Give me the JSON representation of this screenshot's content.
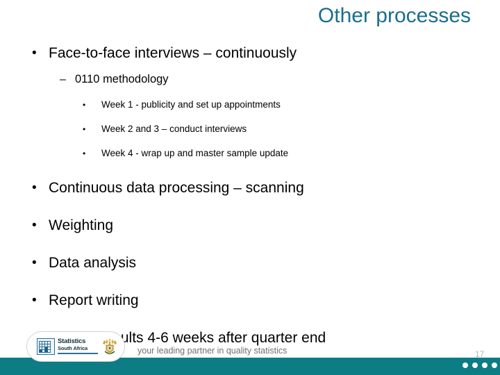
{
  "slide": {
    "title": "Other processes",
    "page_number": "17",
    "title_color": "#1a6d8e",
    "band_color": "#0c7c85"
  },
  "content": {
    "bullets": [
      {
        "level": 1,
        "marker": "•",
        "text": "Face-to-face interviews – continuously"
      },
      {
        "level": 2,
        "marker": "–",
        "text": "0110 methodology"
      },
      {
        "level": 3,
        "marker": "•",
        "text": "Week 1  - publicity and set up appointments"
      },
      {
        "level": 3,
        "marker": "•",
        "text": "Week 2 and 3 – conduct interviews"
      },
      {
        "level": 3,
        "marker": "•",
        "text": "Week 4  - wrap up and master sample update"
      },
      {
        "level": 1,
        "marker": "•",
        "text": "Continuous data processing – scanning"
      },
      {
        "level": 1,
        "marker": "•",
        "text": "Weighting"
      },
      {
        "level": 1,
        "marker": "•",
        "text": "Data analysis"
      },
      {
        "level": 1,
        "marker": "•",
        "text": "Report writing"
      },
      {
        "level": 1,
        "marker": "•",
        "text": "Publish results 4-6 weeks after quarter end"
      }
    ]
  },
  "footer": {
    "logo": {
      "line1": "Statistics",
      "line2": "South Africa"
    },
    "tagline": "your leading partner in quality statistics"
  }
}
